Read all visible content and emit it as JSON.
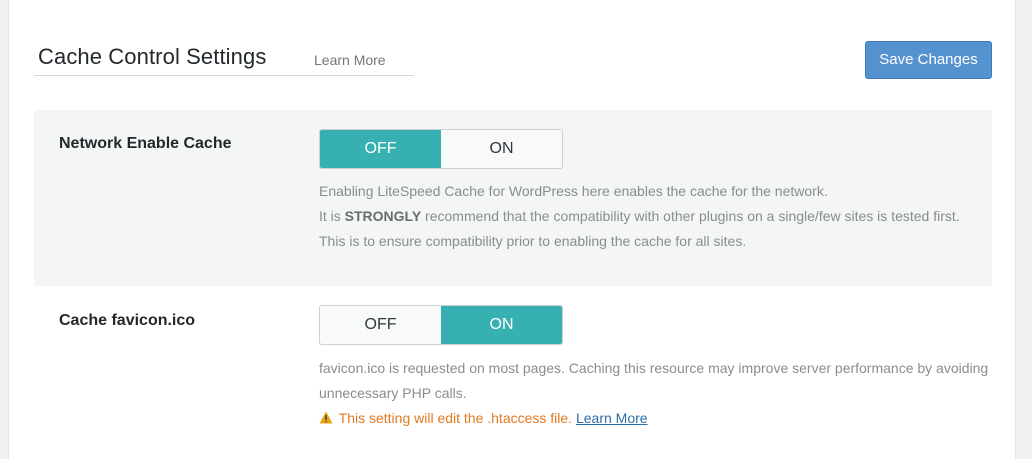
{
  "header": {
    "title": "Cache Control Settings",
    "learn_more": "Learn More",
    "save_label": "Save Changes"
  },
  "settings": [
    {
      "label": "Network Enable Cache",
      "toggle": {
        "off_label": "OFF",
        "on_label": "ON",
        "selected": "OFF"
      },
      "desc_line1": "Enabling LiteSpeed Cache for WordPress here enables the cache for the network.",
      "desc_prefix": "It is ",
      "desc_strong": "STRONGLY",
      "desc_suffix": " recommend that the compatibility with other plugins on a single/few sites is tested first. This is to ensure compatibility prior to enabling the cache for all sites."
    },
    {
      "label": "Cache favicon.ico",
      "toggle": {
        "off_label": "OFF",
        "on_label": "ON",
        "selected": "ON"
      },
      "desc": "favicon.ico is requested on most pages. Caching this resource may improve server performance by avoiding unnecessary PHP calls.",
      "warning_icon": "warning-triangle-icon",
      "warning_text": "This setting will edit the .htaccess file.",
      "warning_link": "Learn More"
    }
  ],
  "colors": {
    "accent": "#36b0b0",
    "button": "#5593d0",
    "warning": "#e07a22",
    "link": "#2e6fa7"
  }
}
